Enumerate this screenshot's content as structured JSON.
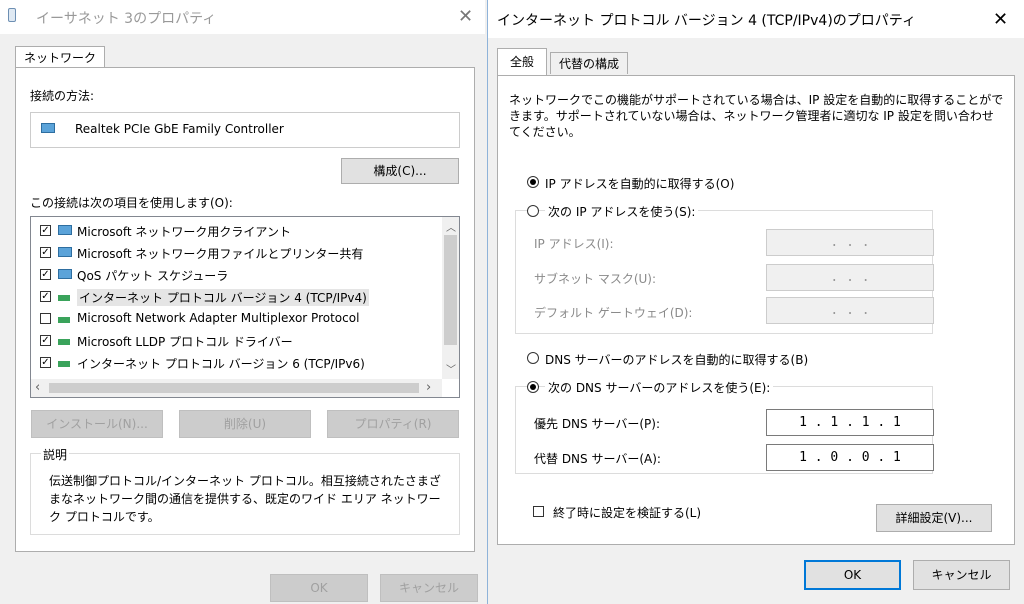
{
  "left_dialog": {
    "title": "イーサネット 3のプロパティ",
    "tab": "ネットワーク",
    "connect_using_label": "接続の方法:",
    "adapter_name": "Realtek PCIe GbE Family Controller",
    "configure_button": "構成(C)...",
    "items_label": "この接続は次の項目を使用します(O):",
    "items": [
      {
        "label": "Microsoft ネットワーク用クライアント",
        "checked": true
      },
      {
        "label": "Microsoft ネットワーク用ファイルとプリンター共有",
        "checked": true
      },
      {
        "label": "QoS パケット スケジューラ",
        "checked": true
      },
      {
        "label": "インターネット プロトコル バージョン 4 (TCP/IPv4)",
        "checked": true
      },
      {
        "label": "Microsoft Network Adapter Multiplexor Protocol",
        "checked": false
      },
      {
        "label": "Microsoft LLDP プロトコル ドライバー",
        "checked": true
      },
      {
        "label": "インターネット プロトコル バージョン 6 (TCP/IPv6)",
        "checked": true
      }
    ],
    "install_button": "インストール(N)...",
    "uninstall_button": "削除(U)",
    "properties_button": "プロパティ(R)",
    "description_label": "説明",
    "description_text": "伝送制御プロトコル/インターネット プロトコル。相互接続されたさまざまなネットワーク間の通信を提供する、既定のワイド エリア ネットワーク プロトコルです。",
    "ok_button": "OK",
    "cancel_button": "キャンセル"
  },
  "right_dialog": {
    "title": "インターネット プロトコル バージョン 4 (TCP/IPv4)のプロパティ",
    "tabs": [
      "全般",
      "代替の構成"
    ],
    "intro_text": "ネットワークでこの機能がサポートされている場合は、IP 設定を自動的に取得することができます。サポートされていない場合は、ネットワーク管理者に適切な IP 設定を問い合わせてください。",
    "auto_ip_label": "IP アドレスを自動的に取得する(O)",
    "manual_ip_label": "次の IP アドレスを使う(S):",
    "ip_address_label": "IP アドレス(I):",
    "subnet_label": "サブネット マスク(U):",
    "gateway_label": "デフォルト ゲートウェイ(D):",
    "empty_ip": ". . .",
    "auto_dns_label": "DNS サーバーのアドレスを自動的に取得する(B)",
    "manual_dns_label": "次の DNS サーバーのアドレスを使う(E):",
    "preferred_dns_label": "優先 DNS サーバー(P):",
    "preferred_dns_value": "1 . 1 . 1 . 1",
    "alternate_dns_label": "代替 DNS サーバー(A):",
    "alternate_dns_value": "1 . 0 . 0 . 1",
    "validate_label": "終了時に設定を検証する(L)",
    "advanced_button": "詳細設定(V)...",
    "ok_button": "OK",
    "cancel_button": "キャンセル"
  }
}
